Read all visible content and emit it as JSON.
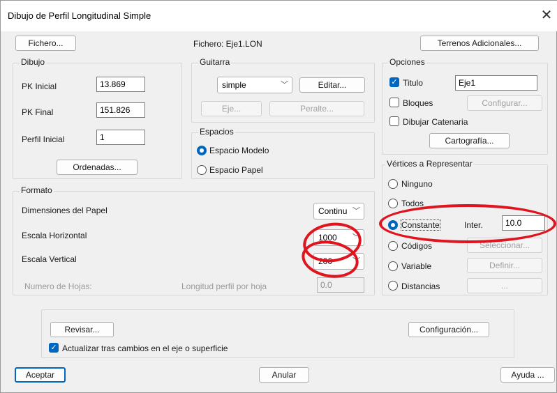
{
  "window": {
    "title": "Dibujo de Perfil Longitudinal Simple"
  },
  "top": {
    "fichero_button": "Fichero...",
    "fichero_label": "Fichero: Eje1.LON",
    "terrenos_button": "Terrenos Adicionales..."
  },
  "dibujo": {
    "title": "Dibujo",
    "pk_inicial_label": "PK Inicial",
    "pk_inicial_value": "13.869",
    "pk_final_label": "PK Final",
    "pk_final_value": "151.826",
    "perfil_inicial_label": "Perfil Inicial",
    "perfil_inicial_value": "1",
    "ordenadas_button": "Ordenadas..."
  },
  "guitarra": {
    "title": "Guitarra",
    "selected": "simple",
    "editar_button": "Editar...",
    "eje_button": "Eje...",
    "peralte_button": "Peralte..."
  },
  "espacios": {
    "title": "Espacios",
    "modelo_label": "Espacio Modelo",
    "papel_label": "Espacio Papel"
  },
  "opciones": {
    "title": "Opciones",
    "titulo_label": "Titulo",
    "titulo_value": "Eje1",
    "bloques_label": "Bloques",
    "configurar_button": "Configurar...",
    "catenaria_label": "Dibujar Catenaria",
    "cartografia_button": "Cartografía..."
  },
  "vertices": {
    "title": "Vértices a Representar",
    "ninguno": "Ninguno",
    "todos": "Todos",
    "constante": "Constante",
    "inter_label": "Inter.",
    "inter_value": "10.0",
    "codigos": "Códigos",
    "seleccionar_button": "Seleccionar...",
    "variable": "Variable",
    "definir_button": "Definir...",
    "distancias": "Distancias",
    "distancias_button": "..."
  },
  "formato": {
    "title": "Formato",
    "dimensiones_label": "Dimensiones del Papel",
    "dimensiones_value": "Continu",
    "escala_h_label": "Escala Horizontal",
    "escala_h_value": "1000",
    "escala_v_label": "Escala Vertical",
    "escala_v_value": "200",
    "num_hojas_label": "Numero de Hojas:",
    "longitud_label": "Longitud perfil por hoja",
    "longitud_value": "0.0"
  },
  "bottom": {
    "revisar_button": "Revisar...",
    "configuracion_button": "Configuración...",
    "actualizar_label": "Actualizar tras cambios en el eje o superficie",
    "aceptar_button": "Aceptar",
    "anular_button": "Anular",
    "ayuda_button": "Ayuda ..."
  },
  "colors": {
    "accent": "#0067c0",
    "annotation": "#e0141e"
  }
}
